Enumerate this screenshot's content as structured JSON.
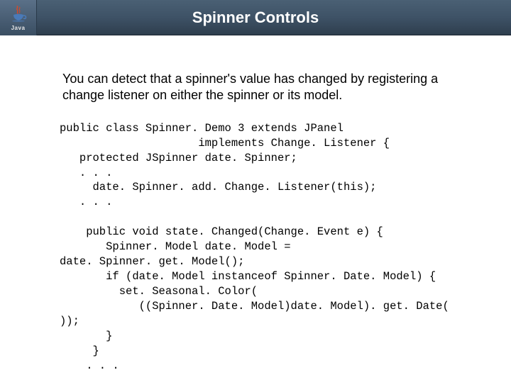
{
  "header": {
    "logo_text": "Java",
    "title": "Spinner Controls"
  },
  "intro": "You can detect that a spinner's value has changed by registering a change listener on either the spinner or its model.",
  "code": "public class Spinner. Demo 3 extends JPanel\n                     implements Change. Listener {\n   protected JSpinner date. Spinner;\n   . . .\n     date. Spinner. add. Change. Listener(this);\n   . . .\n\n    public void state. Changed(Change. Event e) {\n       Spinner. Model date. Model =\ndate. Spinner. get. Model();\n       if (date. Model instanceof Spinner. Date. Model) {\n         set. Seasonal. Color(\n            ((Spinner. Date. Model)date. Model). get. Date(\n));\n       }\n     }\n    . . ."
}
